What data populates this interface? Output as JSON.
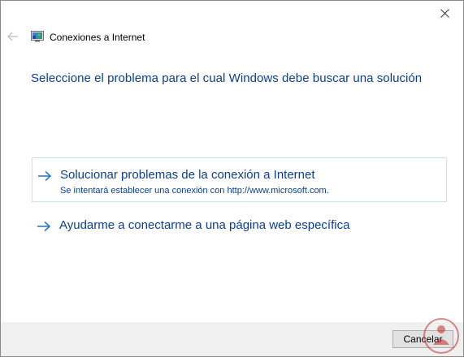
{
  "window": {
    "title": "Conexiones a Internet",
    "close_icon": "close-icon",
    "back_icon": "back-arrow-icon",
    "app_icon": "network-connections-icon"
  },
  "main": {
    "heading": "Seleccione el problema para el cual Windows debe buscar una solución",
    "options": [
      {
        "title": "Solucionar problemas de la conexión a Internet",
        "description": "Se intentará establecer una conexión con http://www.microsoft.com.",
        "icon": "arrow-right-icon"
      },
      {
        "title": "Ayudarme a conectarme a una página web específica",
        "icon": "arrow-right-icon"
      }
    ]
  },
  "footer": {
    "cancel_label": "Cancelar"
  },
  "colors": {
    "link_text": "#0a3f94",
    "arrow": "#2e79c7",
    "option_border": "#c9e1f4",
    "footer_bg": "#f0f0f0"
  }
}
